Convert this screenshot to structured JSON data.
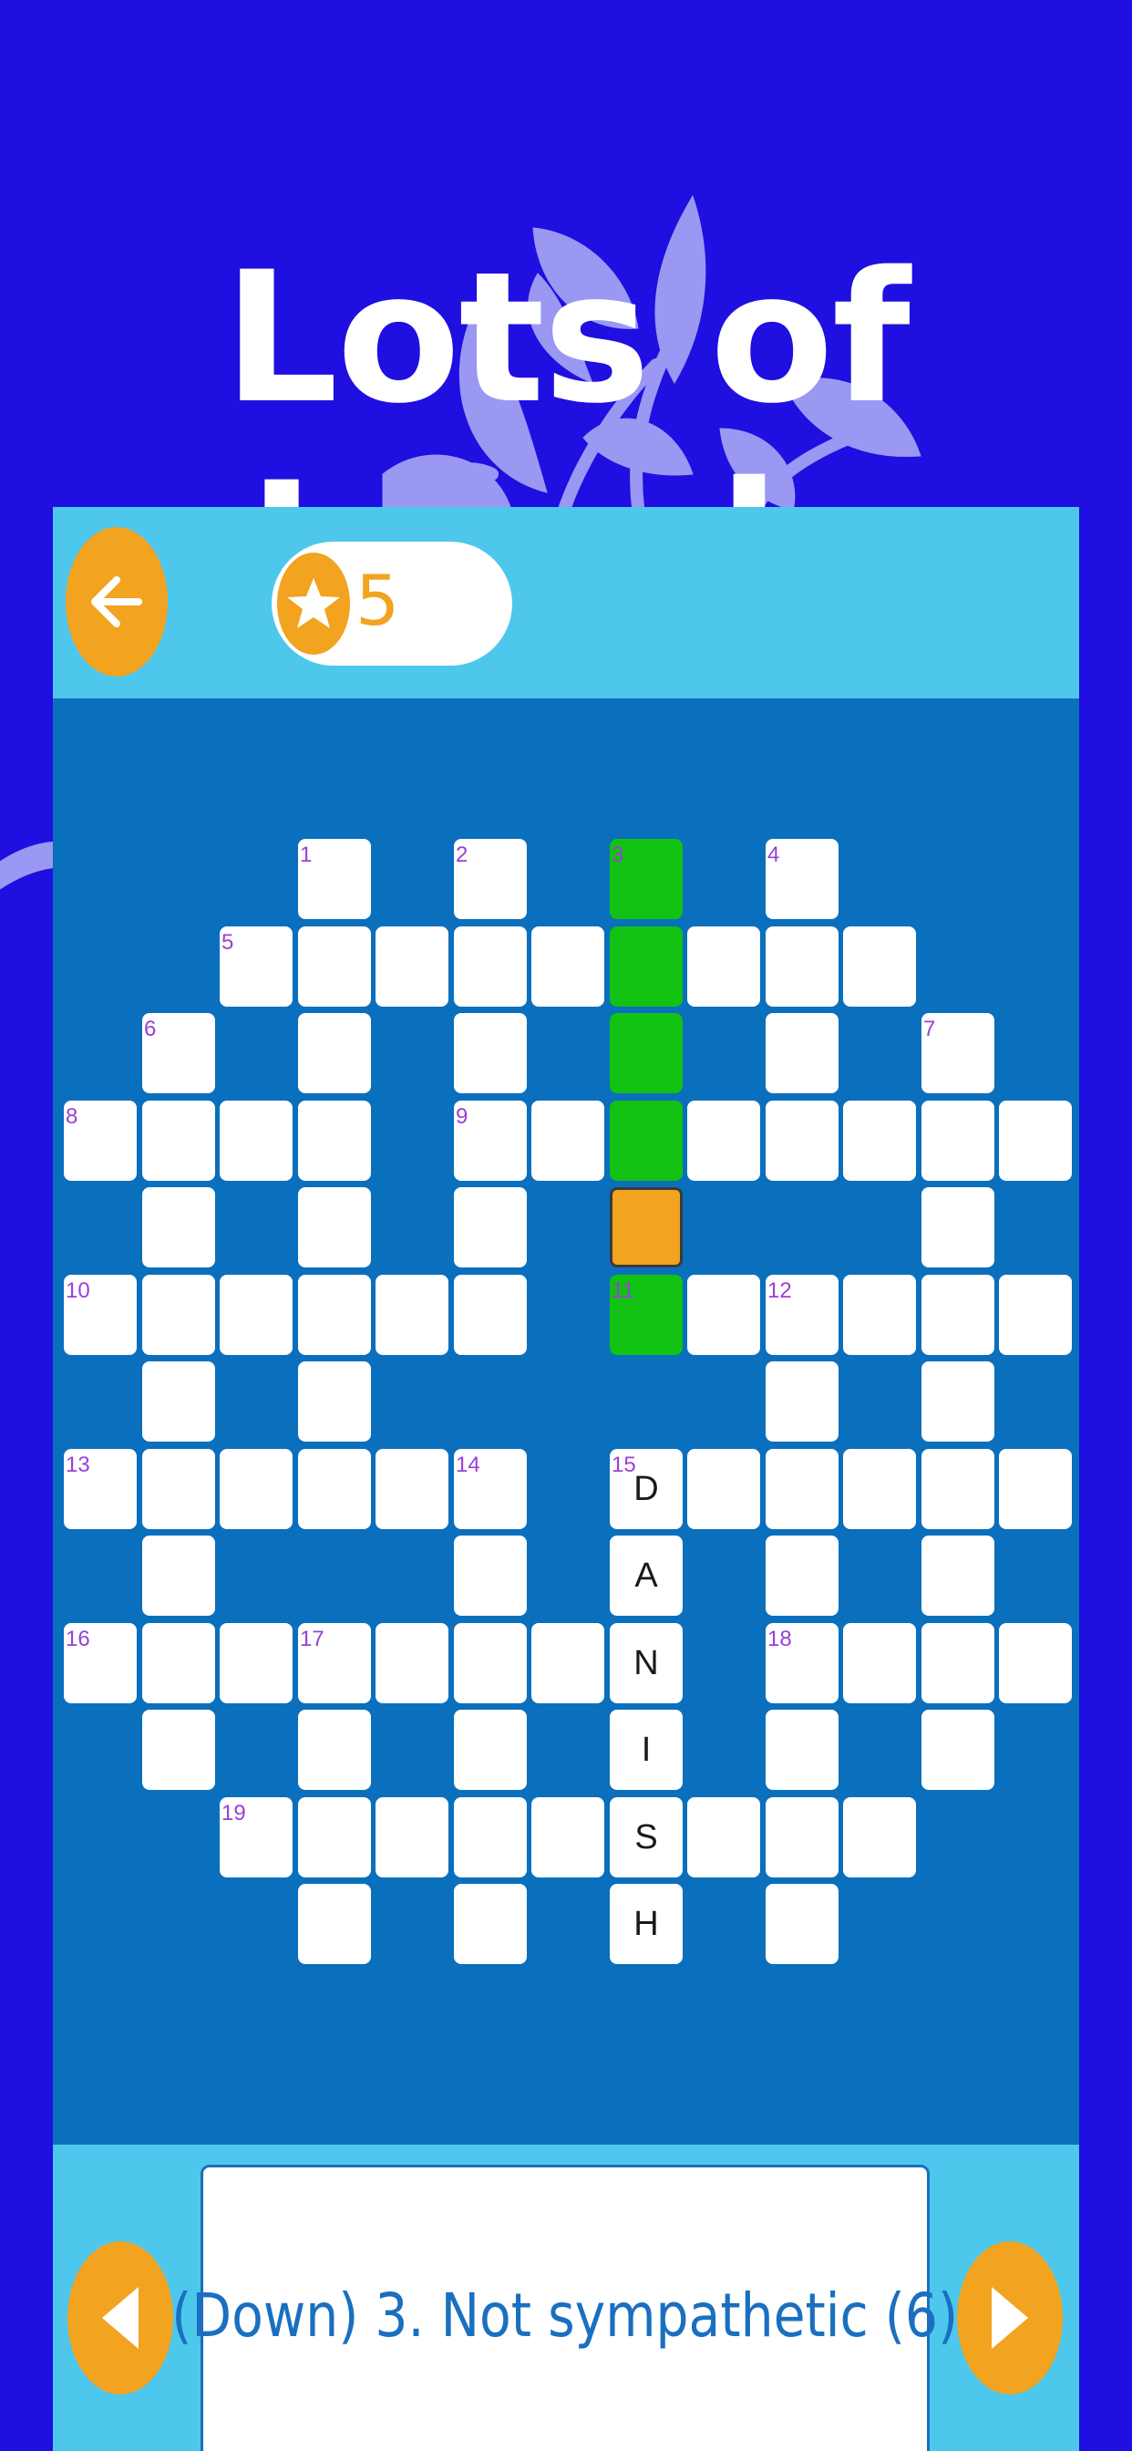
{
  "hero": {
    "title": "Lots of Levels"
  },
  "topbar": {
    "coins": "5"
  },
  "clue": {
    "text": "(Down) 3. Not sympathetic (6)"
  },
  "grid": {
    "cells": [
      {
        "r": 0,
        "c": 3,
        "n": "1"
      },
      {
        "r": 0,
        "c": 5,
        "n": "2"
      },
      {
        "r": 0,
        "c": 7,
        "n": "3",
        "s": "hl"
      },
      {
        "r": 0,
        "c": 9,
        "n": "4"
      },
      {
        "r": 1,
        "c": 2,
        "n": "5"
      },
      {
        "r": 1,
        "c": 3
      },
      {
        "r": 1,
        "c": 4
      },
      {
        "r": 1,
        "c": 5
      },
      {
        "r": 1,
        "c": 6
      },
      {
        "r": 1,
        "c": 7,
        "s": "hl"
      },
      {
        "r": 1,
        "c": 8
      },
      {
        "r": 1,
        "c": 9
      },
      {
        "r": 1,
        "c": 10
      },
      {
        "r": 2,
        "c": 1,
        "n": "6"
      },
      {
        "r": 2,
        "c": 3
      },
      {
        "r": 2,
        "c": 5
      },
      {
        "r": 2,
        "c": 7,
        "s": "hl"
      },
      {
        "r": 2,
        "c": 9
      },
      {
        "r": 2,
        "c": 11,
        "n": "7"
      },
      {
        "r": 3,
        "c": 0,
        "n": "8"
      },
      {
        "r": 3,
        "c": 1
      },
      {
        "r": 3,
        "c": 2
      },
      {
        "r": 3,
        "c": 3
      },
      {
        "r": 3,
        "c": 5,
        "n": "9"
      },
      {
        "r": 3,
        "c": 6
      },
      {
        "r": 3,
        "c": 7,
        "s": "hl"
      },
      {
        "r": 3,
        "c": 8
      },
      {
        "r": 3,
        "c": 9
      },
      {
        "r": 3,
        "c": 10
      },
      {
        "r": 3,
        "c": 11
      },
      {
        "r": 3,
        "c": 12
      },
      {
        "r": 4,
        "c": 1
      },
      {
        "r": 4,
        "c": 3
      },
      {
        "r": 4,
        "c": 5
      },
      {
        "r": 4,
        "c": 7,
        "s": "sel"
      },
      {
        "r": 4,
        "c": 11
      },
      {
        "r": 5,
        "c": 0,
        "n": "10"
      },
      {
        "r": 5,
        "c": 1
      },
      {
        "r": 5,
        "c": 2
      },
      {
        "r": 5,
        "c": 3
      },
      {
        "r": 5,
        "c": 4
      },
      {
        "r": 5,
        "c": 5
      },
      {
        "r": 5,
        "c": 7,
        "n": "11",
        "s": "hl"
      },
      {
        "r": 5,
        "c": 8
      },
      {
        "r": 5,
        "c": 9,
        "n": "12"
      },
      {
        "r": 5,
        "c": 10
      },
      {
        "r": 5,
        "c": 11
      },
      {
        "r": 5,
        "c": 12
      },
      {
        "r": 6,
        "c": 1
      },
      {
        "r": 6,
        "c": 3
      },
      {
        "r": 6,
        "c": 9
      },
      {
        "r": 6,
        "c": 11
      },
      {
        "r": 7,
        "c": 0,
        "n": "13"
      },
      {
        "r": 7,
        "c": 1
      },
      {
        "r": 7,
        "c": 2
      },
      {
        "r": 7,
        "c": 3
      },
      {
        "r": 7,
        "c": 4
      },
      {
        "r": 7,
        "c": 5,
        "n": "14"
      },
      {
        "r": 7,
        "c": 7,
        "n": "15",
        "l": "D"
      },
      {
        "r": 7,
        "c": 8
      },
      {
        "r": 7,
        "c": 9
      },
      {
        "r": 7,
        "c": 10
      },
      {
        "r": 7,
        "c": 11
      },
      {
        "r": 7,
        "c": 12
      },
      {
        "r": 8,
        "c": 1
      },
      {
        "r": 8,
        "c": 5
      },
      {
        "r": 8,
        "c": 7,
        "l": "A"
      },
      {
        "r": 8,
        "c": 9
      },
      {
        "r": 8,
        "c": 11
      },
      {
        "r": 9,
        "c": 0,
        "n": "16"
      },
      {
        "r": 9,
        "c": 1
      },
      {
        "r": 9,
        "c": 2
      },
      {
        "r": 9,
        "c": 3,
        "n": "17"
      },
      {
        "r": 9,
        "c": 4
      },
      {
        "r": 9,
        "c": 5
      },
      {
        "r": 9,
        "c": 6
      },
      {
        "r": 9,
        "c": 7,
        "l": "N"
      },
      {
        "r": 9,
        "c": 9,
        "n": "18"
      },
      {
        "r": 9,
        "c": 10
      },
      {
        "r": 9,
        "c": 11
      },
      {
        "r": 9,
        "c": 12
      },
      {
        "r": 10,
        "c": 1
      },
      {
        "r": 10,
        "c": 3
      },
      {
        "r": 10,
        "c": 5
      },
      {
        "r": 10,
        "c": 7,
        "l": "I"
      },
      {
        "r": 10,
        "c": 9
      },
      {
        "r": 10,
        "c": 11
      },
      {
        "r": 11,
        "c": 2,
        "n": "19"
      },
      {
        "r": 11,
        "c": 3
      },
      {
        "r": 11,
        "c": 4
      },
      {
        "r": 11,
        "c": 5
      },
      {
        "r": 11,
        "c": 6
      },
      {
        "r": 11,
        "c": 7,
        "l": "S"
      },
      {
        "r": 11,
        "c": 8
      },
      {
        "r": 11,
        "c": 9
      },
      {
        "r": 11,
        "c": 10
      },
      {
        "r": 12,
        "c": 3
      },
      {
        "r": 12,
        "c": 5
      },
      {
        "r": 12,
        "c": 7,
        "l": "H"
      },
      {
        "r": 12,
        "c": 9
      }
    ]
  },
  "colors": {
    "background": "#1f0fe0",
    "panel": "#4dc7ec",
    "board": "#0a6fbc",
    "accent": "#f2a31f",
    "highlight": "#12c212",
    "clue_number": "#9b3fd6",
    "clue_text": "#1a6fc0"
  },
  "icons": {
    "back": "arrow-left-icon",
    "coin": "star-icon",
    "prev": "triangle-left-icon",
    "next": "triangle-right-icon"
  }
}
